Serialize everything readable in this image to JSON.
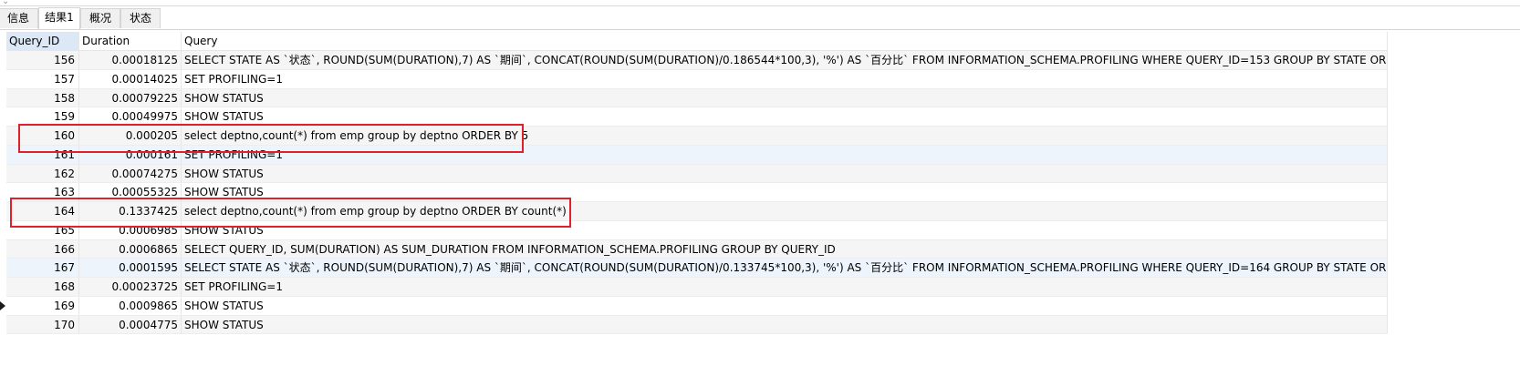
{
  "tabs": [
    {
      "label": "信息"
    },
    {
      "label": "结果1"
    },
    {
      "label": "概况"
    },
    {
      "label": "状态"
    }
  ],
  "active_tab": "结果1",
  "columns": {
    "id": "Query_ID",
    "duration": "Duration",
    "query": "Query"
  },
  "rows": [
    {
      "id": "156",
      "duration": "0.00018125",
      "query": "SELECT STATE AS `状态`, ROUND(SUM(DURATION),7) AS `期间`, CONCAT(ROUND(SUM(DURATION)/0.186544*100,3), '%') AS `百分比` FROM INFORMATION_SCHEMA.PROFILING WHERE QUERY_ID=153 GROUP BY STATE ORDER BY SEQ"
    },
    {
      "id": "157",
      "duration": "0.00014025",
      "query": "SET PROFILING=1"
    },
    {
      "id": "158",
      "duration": "0.00079225",
      "query": "SHOW STATUS"
    },
    {
      "id": "159",
      "duration": "0.00049975",
      "query": "SHOW STATUS"
    },
    {
      "id": "160",
      "duration": "0.000205",
      "query": "select deptno,count(*) from emp group by deptno ORDER BY 5"
    },
    {
      "id": "161",
      "duration": "0.000161",
      "query": "SET PROFILING=1"
    },
    {
      "id": "162",
      "duration": "0.00074275",
      "query": "SHOW STATUS"
    },
    {
      "id": "163",
      "duration": "0.00055325",
      "query": "SHOW STATUS"
    },
    {
      "id": "164",
      "duration": "0.1337425",
      "query": "select deptno,count(*) from emp group by deptno ORDER BY count(*)"
    },
    {
      "id": "165",
      "duration": "0.0006985",
      "query": "SHOW STATUS"
    },
    {
      "id": "166",
      "duration": "0.0006865",
      "query": "SELECT QUERY_ID, SUM(DURATION) AS SUM_DURATION FROM INFORMATION_SCHEMA.PROFILING GROUP BY QUERY_ID"
    },
    {
      "id": "167",
      "duration": "0.0001595",
      "query": "SELECT STATE AS `状态`, ROUND(SUM(DURATION),7) AS `期间`, CONCAT(ROUND(SUM(DURATION)/0.133745*100,3), '%') AS `百分比` FROM INFORMATION_SCHEMA.PROFILING WHERE QUERY_ID=164 GROUP BY STATE ORDER BY SEQ"
    },
    {
      "id": "168",
      "duration": "0.00023725",
      "query": "SET PROFILING=1"
    },
    {
      "id": "169",
      "duration": "0.0009865",
      "query": "SHOW STATUS"
    },
    {
      "id": "170",
      "duration": "0.0004775",
      "query": "SHOW STATUS"
    }
  ],
  "current_row": "169",
  "highlighted_rows": [
    "160",
    "164"
  ],
  "highlight_color": "#e0202a",
  "selected_row_color": "#eef4fb"
}
